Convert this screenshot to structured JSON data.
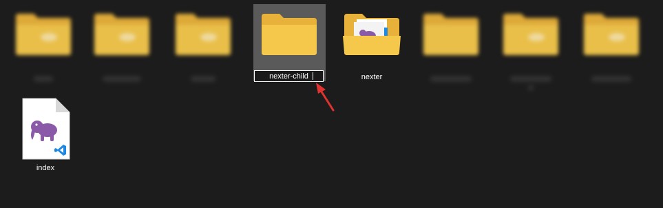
{
  "explorer": {
    "folders": [
      {
        "name": "",
        "blurred": true
      },
      {
        "name": "",
        "blurred": true
      },
      {
        "name": "",
        "blurred": true
      },
      {
        "name": "nexter-child",
        "blurred": false,
        "renaming": true,
        "selected": true
      },
      {
        "name": "nexter",
        "blurred": false,
        "has_contents": true
      },
      {
        "name": "",
        "blurred": true
      },
      {
        "name": "",
        "blurred": true
      },
      {
        "name": "",
        "blurred": true
      }
    ],
    "files": [
      {
        "name": "index",
        "file_icon": "php-elephant-icon",
        "badge_icon": "vscode-icon"
      }
    ],
    "rename_value": "nexter-child",
    "nexter_label": "nexter",
    "index_label": "index"
  },
  "colors": {
    "background": "#1c1c1c",
    "folder_main": "#f5c84c",
    "folder_back": "#e8b13a",
    "selection": "#5a5a5a",
    "arrow": "#e0332f",
    "php_purple": "#8a5aa8",
    "vscode_blue": "#1e88e5"
  }
}
